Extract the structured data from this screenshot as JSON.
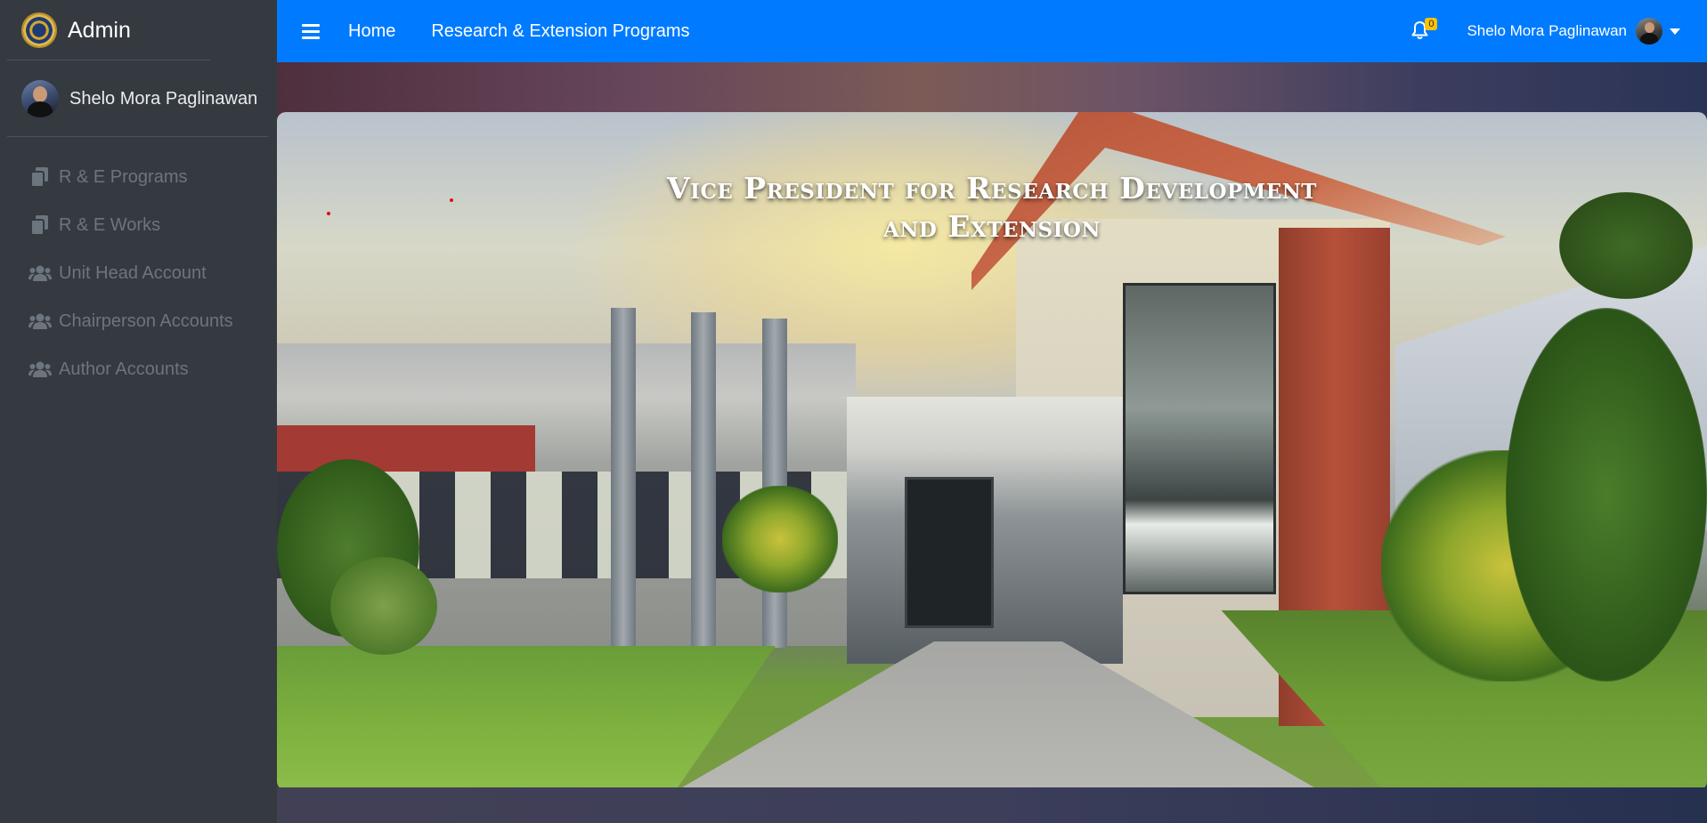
{
  "brand": {
    "name": "Admin",
    "logo_icon": "university-seal-icon"
  },
  "user": {
    "name": "Shelo Mora Paglinawan"
  },
  "sidebar": {
    "items": [
      {
        "label": "R & E Programs",
        "icon": "copy-icon"
      },
      {
        "label": "R & E Works",
        "icon": "copy-icon"
      },
      {
        "label": "Unit Head Account",
        "icon": "users-icon"
      },
      {
        "label": "Chairperson Accounts",
        "icon": "users-icon"
      },
      {
        "label": "Author Accounts",
        "icon": "users-icon"
      }
    ]
  },
  "topbar": {
    "links": [
      {
        "label": "Home"
      },
      {
        "label": "Research & Extension Programs"
      }
    ],
    "notifications": {
      "count": "0",
      "icon": "bell-icon"
    },
    "user_name": "Shelo Mora Paglinawan"
  },
  "hero": {
    "title_line1": "Vice President for Research Development",
    "title_line2": "and Extension"
  },
  "colors": {
    "navbar": "#007bff",
    "sidebar": "#343a40",
    "badge": "#ffc107"
  }
}
